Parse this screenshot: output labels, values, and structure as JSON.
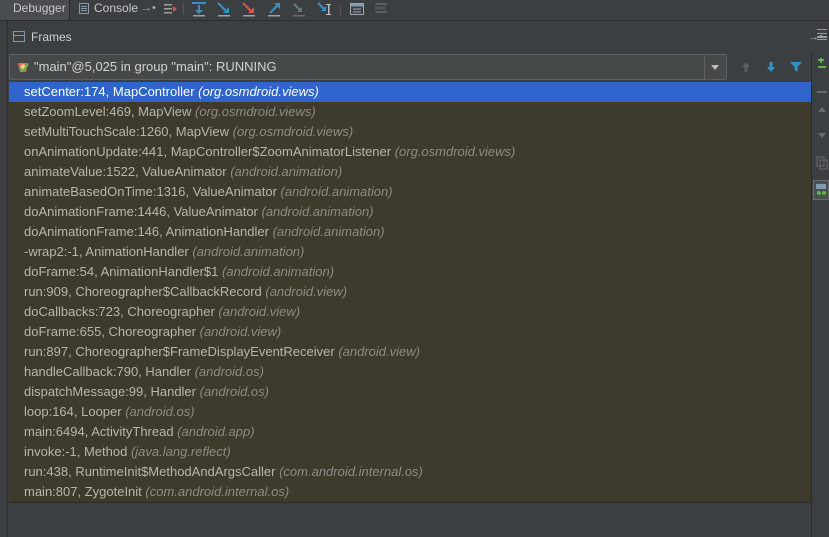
{
  "toolbar": {
    "debugger_tab": "Debugger",
    "console_tab": "Console",
    "pin_glyph": "→•"
  },
  "frames_panel": {
    "title": "Frames"
  },
  "thread_selector": {
    "value": "\"main\"@5,025 in group \"main\": RUNNING"
  },
  "frames": [
    {
      "method": "setCenter:174, MapController ",
      "package": "(org.osmdroid.views)"
    },
    {
      "method": "setZoomLevel:469, MapView ",
      "package": "(org.osmdroid.views)"
    },
    {
      "method": "setMultiTouchScale:1260, MapView ",
      "package": "(org.osmdroid.views)"
    },
    {
      "method": "onAnimationUpdate:441, MapController$ZoomAnimatorListener ",
      "package": "(org.osmdroid.views)"
    },
    {
      "method": "animateValue:1522, ValueAnimator ",
      "package": "(android.animation)"
    },
    {
      "method": "animateBasedOnTime:1316, ValueAnimator ",
      "package": "(android.animation)"
    },
    {
      "method": "doAnimationFrame:1446, ValueAnimator ",
      "package": "(android.animation)"
    },
    {
      "method": "doAnimationFrame:146, AnimationHandler ",
      "package": "(android.animation)"
    },
    {
      "method": "-wrap2:-1, AnimationHandler ",
      "package": "(android.animation)"
    },
    {
      "method": "doFrame:54, AnimationHandler$1 ",
      "package": "(android.animation)"
    },
    {
      "method": "run:909, Choreographer$CallbackRecord ",
      "package": "(android.view)"
    },
    {
      "method": "doCallbacks:723, Choreographer ",
      "package": "(android.view)"
    },
    {
      "method": "doFrame:655, Choreographer ",
      "package": "(android.view)"
    },
    {
      "method": "run:897, Choreographer$FrameDisplayEventReceiver ",
      "package": "(android.view)"
    },
    {
      "method": "handleCallback:790, Handler ",
      "package": "(android.os)"
    },
    {
      "method": "dispatchMessage:99, Handler ",
      "package": "(android.os)"
    },
    {
      "method": "loop:164, Looper ",
      "package": "(android.os)"
    },
    {
      "method": "main:6494, ActivityThread ",
      "package": "(android.app)"
    },
    {
      "method": "invoke:-1, Method ",
      "package": "(java.lang.reflect)"
    },
    {
      "method": "run:438, RuntimeInit$MethodAndArgsCaller ",
      "package": "(com.android.internal.os)"
    },
    {
      "method": "main:807, ZygoteInit ",
      "package": "(com.android.internal.os)"
    }
  ],
  "colors": {
    "selection": "#2f65ca",
    "frames_bg": "#3e3a2c",
    "ide_bg": "#3c3f41",
    "icon_blue": "#3592c4",
    "icon_red": "#e05050"
  }
}
